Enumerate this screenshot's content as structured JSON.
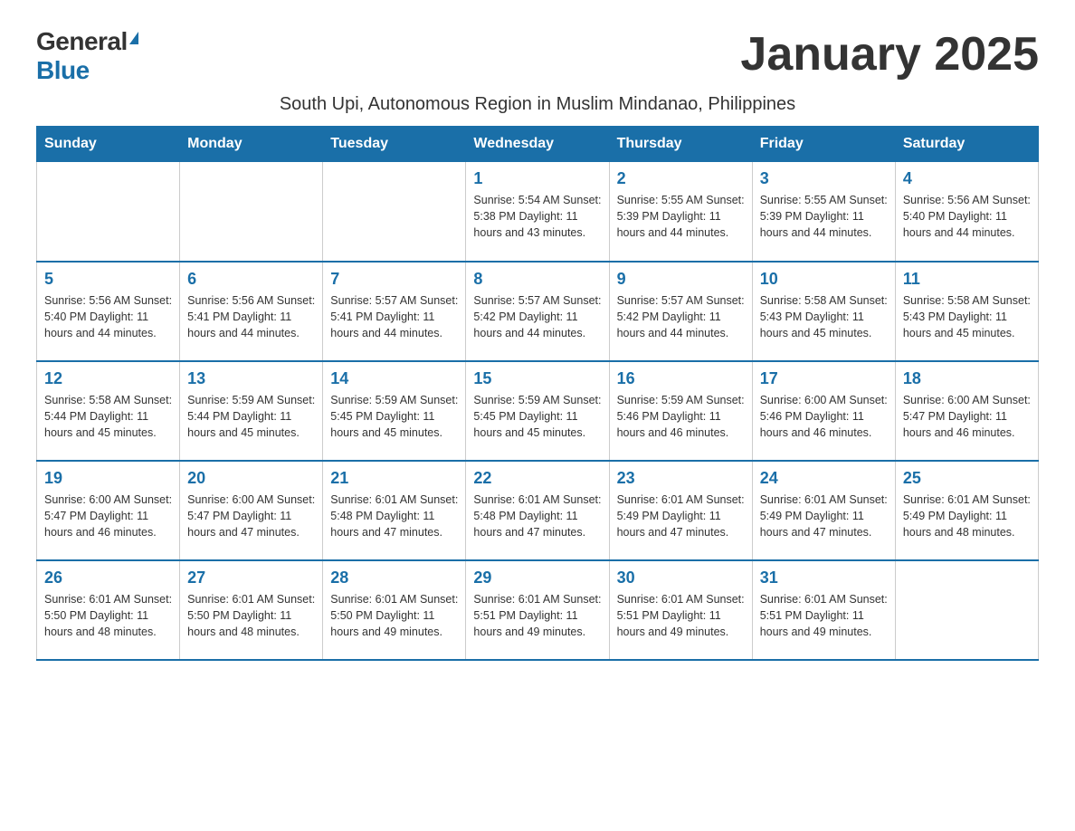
{
  "logo": {
    "general": "General",
    "blue": "Blue"
  },
  "title": "January 2025",
  "subtitle": "South Upi, Autonomous Region in Muslim Mindanao, Philippines",
  "days_of_week": [
    "Sunday",
    "Monday",
    "Tuesday",
    "Wednesday",
    "Thursday",
    "Friday",
    "Saturday"
  ],
  "weeks": [
    {
      "days": [
        {
          "number": "",
          "info": ""
        },
        {
          "number": "",
          "info": ""
        },
        {
          "number": "",
          "info": ""
        },
        {
          "number": "1",
          "info": "Sunrise: 5:54 AM\nSunset: 5:38 PM\nDaylight: 11 hours and 43 minutes."
        },
        {
          "number": "2",
          "info": "Sunrise: 5:55 AM\nSunset: 5:39 PM\nDaylight: 11 hours and 44 minutes."
        },
        {
          "number": "3",
          "info": "Sunrise: 5:55 AM\nSunset: 5:39 PM\nDaylight: 11 hours and 44 minutes."
        },
        {
          "number": "4",
          "info": "Sunrise: 5:56 AM\nSunset: 5:40 PM\nDaylight: 11 hours and 44 minutes."
        }
      ]
    },
    {
      "days": [
        {
          "number": "5",
          "info": "Sunrise: 5:56 AM\nSunset: 5:40 PM\nDaylight: 11 hours and 44 minutes."
        },
        {
          "number": "6",
          "info": "Sunrise: 5:56 AM\nSunset: 5:41 PM\nDaylight: 11 hours and 44 minutes."
        },
        {
          "number": "7",
          "info": "Sunrise: 5:57 AM\nSunset: 5:41 PM\nDaylight: 11 hours and 44 minutes."
        },
        {
          "number": "8",
          "info": "Sunrise: 5:57 AM\nSunset: 5:42 PM\nDaylight: 11 hours and 44 minutes."
        },
        {
          "number": "9",
          "info": "Sunrise: 5:57 AM\nSunset: 5:42 PM\nDaylight: 11 hours and 44 minutes."
        },
        {
          "number": "10",
          "info": "Sunrise: 5:58 AM\nSunset: 5:43 PM\nDaylight: 11 hours and 45 minutes."
        },
        {
          "number": "11",
          "info": "Sunrise: 5:58 AM\nSunset: 5:43 PM\nDaylight: 11 hours and 45 minutes."
        }
      ]
    },
    {
      "days": [
        {
          "number": "12",
          "info": "Sunrise: 5:58 AM\nSunset: 5:44 PM\nDaylight: 11 hours and 45 minutes."
        },
        {
          "number": "13",
          "info": "Sunrise: 5:59 AM\nSunset: 5:44 PM\nDaylight: 11 hours and 45 minutes."
        },
        {
          "number": "14",
          "info": "Sunrise: 5:59 AM\nSunset: 5:45 PM\nDaylight: 11 hours and 45 minutes."
        },
        {
          "number": "15",
          "info": "Sunrise: 5:59 AM\nSunset: 5:45 PM\nDaylight: 11 hours and 45 minutes."
        },
        {
          "number": "16",
          "info": "Sunrise: 5:59 AM\nSunset: 5:46 PM\nDaylight: 11 hours and 46 minutes."
        },
        {
          "number": "17",
          "info": "Sunrise: 6:00 AM\nSunset: 5:46 PM\nDaylight: 11 hours and 46 minutes."
        },
        {
          "number": "18",
          "info": "Sunrise: 6:00 AM\nSunset: 5:47 PM\nDaylight: 11 hours and 46 minutes."
        }
      ]
    },
    {
      "days": [
        {
          "number": "19",
          "info": "Sunrise: 6:00 AM\nSunset: 5:47 PM\nDaylight: 11 hours and 46 minutes."
        },
        {
          "number": "20",
          "info": "Sunrise: 6:00 AM\nSunset: 5:47 PM\nDaylight: 11 hours and 47 minutes."
        },
        {
          "number": "21",
          "info": "Sunrise: 6:01 AM\nSunset: 5:48 PM\nDaylight: 11 hours and 47 minutes."
        },
        {
          "number": "22",
          "info": "Sunrise: 6:01 AM\nSunset: 5:48 PM\nDaylight: 11 hours and 47 minutes."
        },
        {
          "number": "23",
          "info": "Sunrise: 6:01 AM\nSunset: 5:49 PM\nDaylight: 11 hours and 47 minutes."
        },
        {
          "number": "24",
          "info": "Sunrise: 6:01 AM\nSunset: 5:49 PM\nDaylight: 11 hours and 47 minutes."
        },
        {
          "number": "25",
          "info": "Sunrise: 6:01 AM\nSunset: 5:49 PM\nDaylight: 11 hours and 48 minutes."
        }
      ]
    },
    {
      "days": [
        {
          "number": "26",
          "info": "Sunrise: 6:01 AM\nSunset: 5:50 PM\nDaylight: 11 hours and 48 minutes."
        },
        {
          "number": "27",
          "info": "Sunrise: 6:01 AM\nSunset: 5:50 PM\nDaylight: 11 hours and 48 minutes."
        },
        {
          "number": "28",
          "info": "Sunrise: 6:01 AM\nSunset: 5:50 PM\nDaylight: 11 hours and 49 minutes."
        },
        {
          "number": "29",
          "info": "Sunrise: 6:01 AM\nSunset: 5:51 PM\nDaylight: 11 hours and 49 minutes."
        },
        {
          "number": "30",
          "info": "Sunrise: 6:01 AM\nSunset: 5:51 PM\nDaylight: 11 hours and 49 minutes."
        },
        {
          "number": "31",
          "info": "Sunrise: 6:01 AM\nSunset: 5:51 PM\nDaylight: 11 hours and 49 minutes."
        },
        {
          "number": "",
          "info": ""
        }
      ]
    }
  ]
}
